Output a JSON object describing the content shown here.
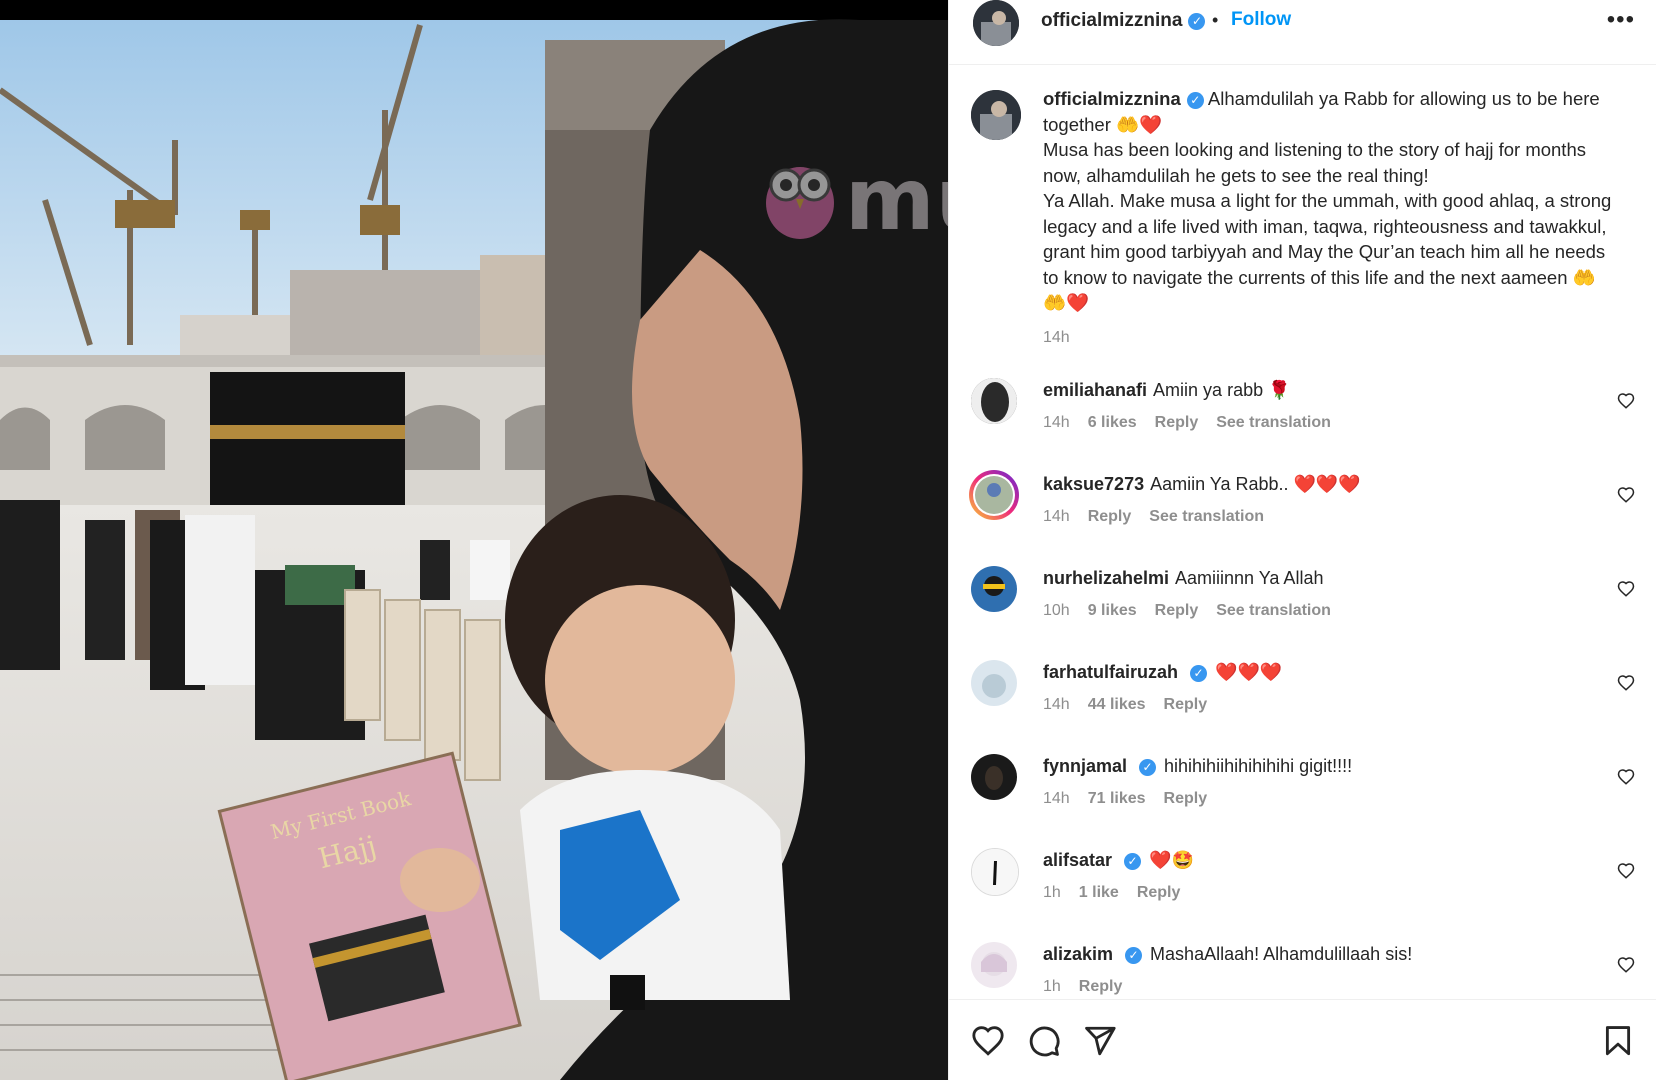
{
  "post": {
    "username": "officialmizznina",
    "separator": "•",
    "follow_label": "Follow",
    "more_icon": "more-options-icon",
    "more_glyph": "•••"
  },
  "watermark": {
    "text": "mur"
  },
  "caption": {
    "username": "officialmizznina",
    "line1": "Alhamdulilah ya Rabb for allowing us to be here together 🤲❤️",
    "line2": "Musa has been looking and listening to the story of hajj for months now, alhamdulilah he gets to see the real thing!",
    "line3": "Ya Allah. Make musa a light for the ummah, with good ahlaq, a strong legacy and a life lived with iman, taqwa, righteousness and tawakkul, grant him good tarbiyyah and May the Qur’an teach him all he needs to know to navigate the currents of this life and the next aameen 🤲🤲❤️",
    "time": "14h"
  },
  "comments": [
    {
      "username": "emiliahanafi",
      "verified": false,
      "text": "Amiin ya rabb 🌹",
      "time": "14h",
      "likes": "6 likes",
      "reply": "Reply",
      "translate": "See translation",
      "avatar_color": "#3a3a3a"
    },
    {
      "username": "kaksue7273",
      "verified": false,
      "text": "Aamiin Ya Rabb.. ❤️❤️❤️",
      "time": "14h",
      "likes": "",
      "reply": "Reply",
      "translate": "See translation",
      "avatar_color": "#a9b7a0"
    },
    {
      "username": "nurhelizahelmi",
      "verified": false,
      "text": "Aamiiinnn Ya Allah",
      "time": "10h",
      "likes": "9 likes",
      "reply": "Reply",
      "translate": "See translation",
      "avatar_color": "#2f6fb0"
    },
    {
      "username": "farhatulfairuzah",
      "verified": true,
      "text": "❤️❤️❤️",
      "time": "14h",
      "likes": "44 likes",
      "reply": "Reply",
      "translate": "",
      "avatar_color": "#b9cbd6"
    },
    {
      "username": "fynnjamal",
      "verified": true,
      "text": "hihihihiihihihihihi gigit!!!!",
      "time": "14h",
      "likes": "71 likes",
      "reply": "Reply",
      "translate": "",
      "avatar_color": "#1a1a1a"
    },
    {
      "username": "alifsatar",
      "verified": true,
      "text": "❤️🤩",
      "time": "1h",
      "likes": "1 like",
      "reply": "Reply",
      "translate": "",
      "avatar_color": "#f4f4f4"
    },
    {
      "username": "alizakim",
      "verified": true,
      "text": "MashaAllaah! Alhamdulillaah sis!",
      "time": "1h",
      "likes": "",
      "reply": "Reply",
      "translate": "",
      "avatar_color": "#e6dde6"
    }
  ],
  "actions": {
    "like_icon": "heart-icon",
    "comment_icon": "comment-icon",
    "share_icon": "share-icon",
    "save_icon": "bookmark-icon"
  },
  "colors": {
    "link": "#0095f6",
    "verified": "#3897f0",
    "muted": "#8e8e8e",
    "text": "#262626"
  }
}
